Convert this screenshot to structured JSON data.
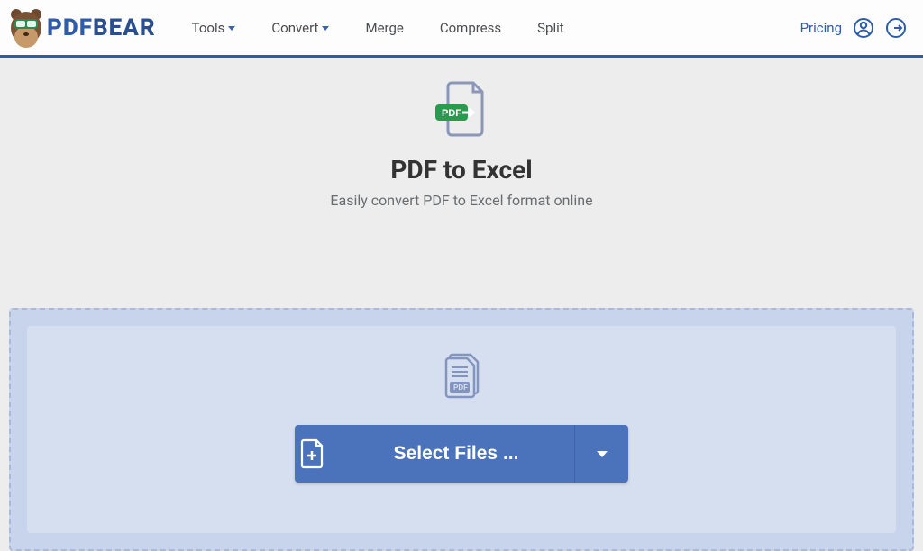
{
  "brand": {
    "part1": "PDF",
    "part2": "BEAR"
  },
  "nav": {
    "tools": "Tools",
    "convert": "Convert",
    "merge": "Merge",
    "compress": "Compress",
    "split": "Split",
    "pricing": "Pricing"
  },
  "hero": {
    "badge": "PDF",
    "title": "PDF to Excel",
    "subtitle": "Easily convert PDF to Excel format online"
  },
  "dropzone": {
    "stack_badge": "PDF",
    "select_label": "Select Files ..."
  }
}
